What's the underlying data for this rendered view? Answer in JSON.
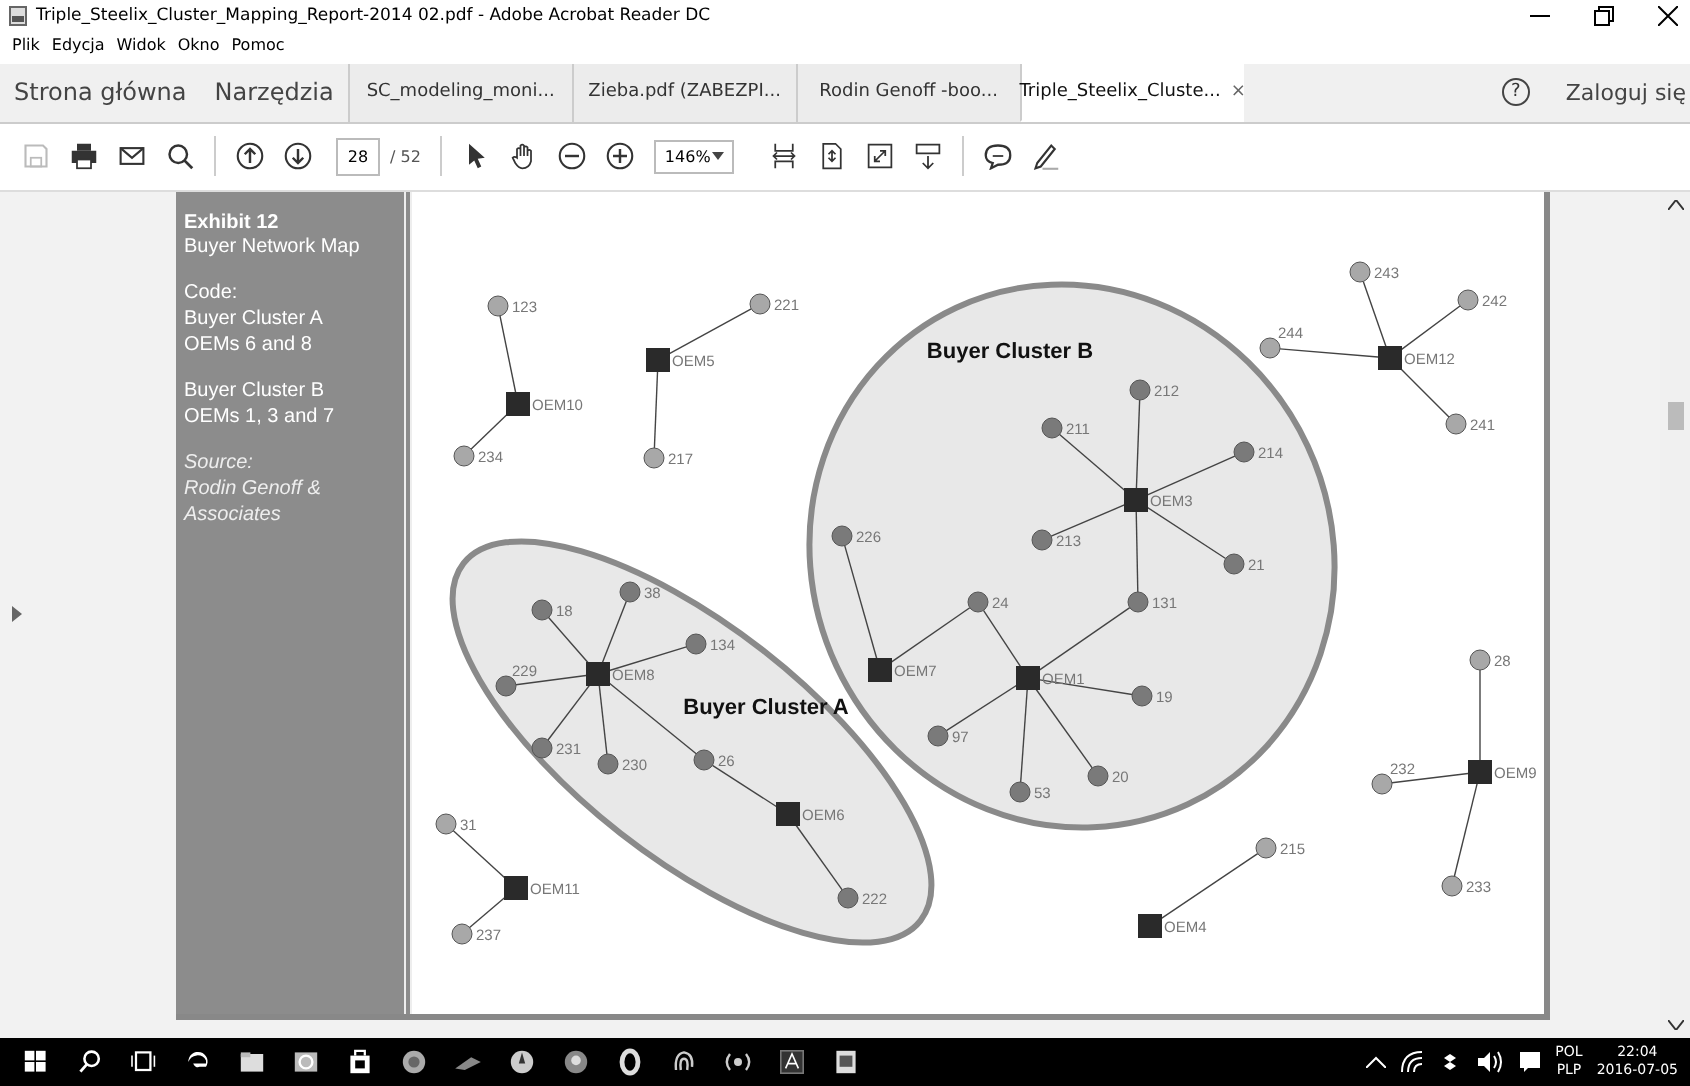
{
  "window": {
    "title": "Triple_Steelix_Cluster_Mapping_Report-2014 02.pdf - Adobe Acrobat Reader DC"
  },
  "menu": [
    "Plik",
    "Edycja",
    "Widok",
    "Okno",
    "Pomoc"
  ],
  "tabs": [
    {
      "label": "Strona główna",
      "kind": "nav",
      "selected": false
    },
    {
      "label": "Narzędzia",
      "kind": "nav",
      "selected": false
    },
    {
      "label": "SC_modeling_moni...",
      "kind": "doc",
      "selected": false
    },
    {
      "label": "Zieba.pdf (ZABEZPI...",
      "kind": "doc",
      "selected": false
    },
    {
      "label": "Rodin Genoff -boo...",
      "kind": "doc",
      "selected": false
    },
    {
      "label": "Triple_Steelix_Cluste...",
      "kind": "doc",
      "selected": true,
      "close": "×"
    }
  ],
  "account": {
    "help": "?",
    "sign_in": "Zaloguj się"
  },
  "toolbar": {
    "page": "28",
    "pages": "/ 52",
    "zoom": "146%"
  },
  "sidebar": {
    "title": "Exhibit 12",
    "subtitle": "Buyer Network Map",
    "blocks": [
      {
        "kind": "plain",
        "lines": [
          "Code:",
          "Buyer Cluster A",
          "OEMs 6 and 8"
        ]
      },
      {
        "kind": "plain",
        "lines": [
          "Buyer Cluster B",
          "OEMs 1, 3 and 7"
        ]
      },
      {
        "kind": "source",
        "lines": [
          "Source:",
          "Rodin Genoff &",
          "Associates"
        ]
      }
    ]
  },
  "diagram": {
    "clusters": [
      {
        "label": "Buyer Cluster A"
      },
      {
        "label": "Buyer Cluster B"
      }
    ],
    "nodes": [
      {
        "label": "243",
        "kind": "buyer",
        "color": "#a8a8a8"
      },
      {
        "label": "123",
        "kind": "buyer",
        "color": "#a8a8a8"
      },
      {
        "label": "221",
        "kind": "buyer",
        "color": "#a8a8a8"
      },
      {
        "label": "242",
        "kind": "buyer",
        "color": "#a8a8a8"
      },
      {
        "label": "OEM5",
        "kind": "oem"
      },
      {
        "label": "244",
        "kind": "buyer",
        "color": "#a8a8a8"
      },
      {
        "label": "OEM12",
        "kind": "oem"
      },
      {
        "label": "212",
        "kind": "buyer",
        "color": "#7a7a7a"
      },
      {
        "label": "OEM10",
        "kind": "oem"
      },
      {
        "label": "211",
        "kind": "buyer",
        "color": "#7a7a7a"
      },
      {
        "label": "241",
        "kind": "buyer",
        "color": "#a8a8a8"
      },
      {
        "label": "234",
        "kind": "buyer",
        "color": "#a8a8a8"
      },
      {
        "label": "217",
        "kind": "buyer",
        "color": "#a8a8a8"
      },
      {
        "label": "214",
        "kind": "buyer",
        "color": "#7a7a7a"
      },
      {
        "label": "OEM3",
        "kind": "oem"
      },
      {
        "label": "226",
        "kind": "buyer",
        "color": "#7a7a7a"
      },
      {
        "label": "213",
        "kind": "buyer",
        "color": "#7a7a7a"
      },
      {
        "label": "21",
        "kind": "buyer",
        "color": "#7a7a7a"
      },
      {
        "label": "18",
        "kind": "buyer",
        "color": "#7a7a7a"
      },
      {
        "label": "38",
        "kind": "buyer",
        "color": "#7a7a7a"
      },
      {
        "label": "24",
        "kind": "buyer",
        "color": "#7a7a7a"
      },
      {
        "label": "131",
        "kind": "buyer",
        "color": "#7a7a7a"
      },
      {
        "label": "134",
        "kind": "buyer",
        "color": "#7a7a7a"
      },
      {
        "label": "229",
        "kind": "buyer",
        "color": "#7a7a7a"
      },
      {
        "label": "OEM8",
        "kind": "oem"
      },
      {
        "label": "OEM7",
        "kind": "oem"
      },
      {
        "label": "OEM1",
        "kind": "oem"
      },
      {
        "label": "28",
        "kind": "buyer",
        "color": "#a8a8a8"
      },
      {
        "label": "19",
        "kind": "buyer",
        "color": "#7a7a7a"
      },
      {
        "label": "97",
        "kind": "buyer",
        "color": "#7a7a7a"
      },
      {
        "label": "231",
        "kind": "buyer",
        "color": "#7a7a7a"
      },
      {
        "label": "230",
        "kind": "buyer",
        "color": "#7a7a7a"
      },
      {
        "label": "26",
        "kind": "buyer",
        "color": "#7a7a7a"
      },
      {
        "label": "53",
        "kind": "buyer",
        "color": "#7a7a7a"
      },
      {
        "label": "20",
        "kind": "buyer",
        "color": "#7a7a7a"
      },
      {
        "label": "232",
        "kind": "buyer",
        "color": "#a8a8a8"
      },
      {
        "label": "OEM9",
        "kind": "oem"
      },
      {
        "label": "OEM6",
        "kind": "oem"
      },
      {
        "label": "31",
        "kind": "buyer",
        "color": "#a8a8a8"
      },
      {
        "label": "215",
        "kind": "buyer",
        "color": "#a8a8a8"
      },
      {
        "label": "OEM11",
        "kind": "oem"
      },
      {
        "label": "222",
        "kind": "buyer",
        "color": "#7a7a7a"
      },
      {
        "label": "233",
        "kind": "buyer",
        "color": "#a8a8a8"
      },
      {
        "label": "237",
        "kind": "buyer",
        "color": "#a8a8a8"
      },
      {
        "label": "OEM4",
        "kind": "oem"
      }
    ]
  },
  "taskbar": {
    "language": "POL",
    "layout": "PLP",
    "time": "22:04",
    "date": "2016-07-05"
  }
}
